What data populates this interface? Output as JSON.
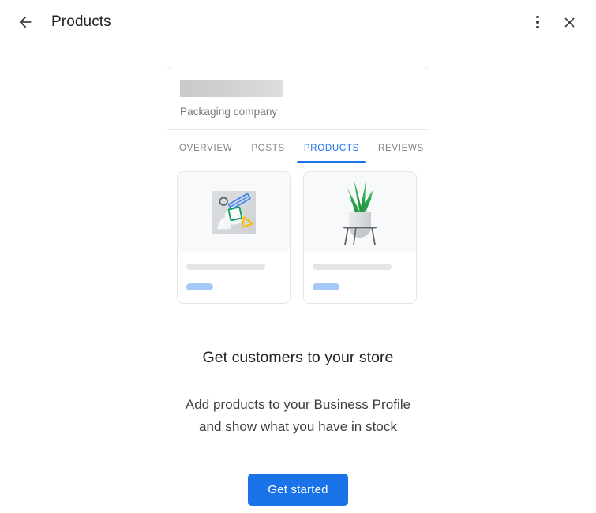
{
  "header": {
    "back_icon": "arrow-left-icon",
    "title": "Products",
    "overflow_icon": "more-vert-icon",
    "close_icon": "close-icon"
  },
  "preview": {
    "business_name_redacted": "",
    "business_category": "Packaging company",
    "tabs": [
      {
        "label": "OVERVIEW",
        "active": false
      },
      {
        "label": "POSTS",
        "active": false
      },
      {
        "label": "PRODUCTS",
        "active": true
      },
      {
        "label": "REVIEWS",
        "active": false
      }
    ],
    "products": [
      {
        "thumb_icon": "image-placeholder-shapes-icon",
        "title_placeholder": "",
        "price_placeholder": ""
      },
      {
        "thumb_icon": "potted-plant-icon",
        "title_placeholder": "",
        "price_placeholder": ""
      }
    ]
  },
  "promo": {
    "headline": "Get customers to your store",
    "subcopy_line1": "Add products to your Business Profile",
    "subcopy_line2": "and show what you have in stock",
    "cta_label": "Get started"
  },
  "colors": {
    "accent_blue": "#1a73e8",
    "text_primary": "#202124",
    "text_secondary": "#70757a",
    "skeleton_gray": "#e4e5e7",
    "skeleton_blue": "#a6c8f7",
    "surface": "#ffffff",
    "thumb_bg": "#f8f9fa",
    "plant_green": "#34a853",
    "shape_yellow": "#fbbc04"
  }
}
